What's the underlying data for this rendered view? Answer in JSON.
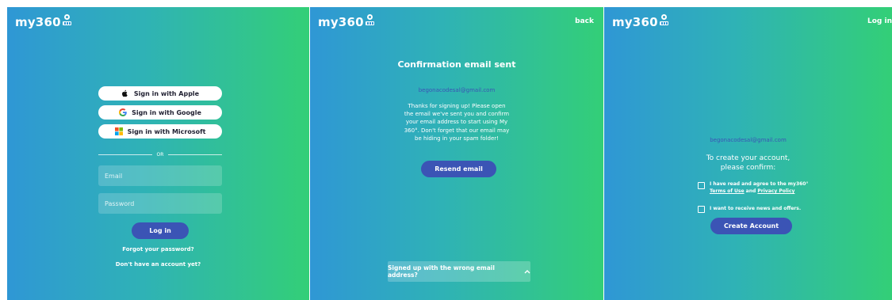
{
  "brand": {
    "logo_text": "my360"
  },
  "panel_login": {
    "apple_label": "Sign in with Apple",
    "google_label": "Sign in with Google",
    "microsoft_label": "Sign in with Microsoft",
    "divider_text": "OR",
    "email_placeholder": "Email",
    "password_placeholder": "Password",
    "login_label": "Log in",
    "forgot_label": "Forgot your password?",
    "no_account_label": "Don't have an account yet?"
  },
  "panel_confirm": {
    "back_label": "back",
    "title": "Confirmation email sent",
    "email": "begonacodesal@gmail.com",
    "message": "Thanks for signing up! Please open the email we've sent you and confirm your email address to start using My 360°. Don't forget that our email may be hiding in your spam folder!",
    "resend_label": "Resend email",
    "wrong_address_label": "Signed up with the wrong email address?"
  },
  "panel_create": {
    "login_link": "Log in",
    "email": "begonacodesal@gmail.com",
    "confirm_line1": "To create your account,",
    "confirm_line2": "please confirm:",
    "terms_prefix": "I have read and agree to the my360°",
    "terms_link": "Terms of Use",
    "terms_and": "and",
    "privacy_link": "Privacy Policy",
    "news_label": "I want to receive news and offers.",
    "create_label": "Create Account"
  },
  "colors": {
    "gradient_left": "#2f97d5",
    "gradient_right": "#33cf77",
    "primary_button": "#3b54b5",
    "email_text": "#3b54b5"
  },
  "icons": [
    "apple-icon",
    "google-icon",
    "microsoft-icon",
    "chevron-up-icon",
    "logo-icon"
  ]
}
